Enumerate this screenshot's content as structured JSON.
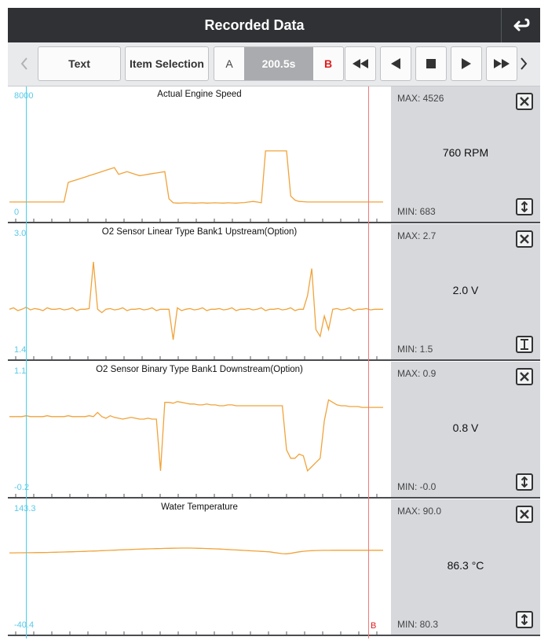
{
  "header": {
    "title": "Recorded Data",
    "back_icon": "return-arrow-icon"
  },
  "toolbar": {
    "text_label": "Text",
    "item_selection_label": "Item Selection",
    "a_label": "A",
    "time_value": "200.5s",
    "b_label": "B",
    "icons": [
      "chevron-left-icon",
      "fast-rewind-icon",
      "step-back-icon",
      "stop-icon",
      "play-icon",
      "fast-forward-icon",
      "chevron-right-icon"
    ]
  },
  "cursor_b_label": "B",
  "colors": {
    "trace": "#f0a33a",
    "cursor_a": "#41d2ea",
    "cursor_b": "#f07a7a",
    "side_panel": "#d6d8dc"
  },
  "panels": [
    {
      "title": "Actual Engine Speed",
      "y_max": "8000",
      "y_min": "0",
      "max_label": "MAX: 4526",
      "min_label": "MIN: 683",
      "current_value": "760 RPM",
      "scale_icon": "expand-vertical-icon",
      "y_range": [
        0,
        8000
      ],
      "values": [
        760,
        760,
        760,
        760,
        760,
        760,
        760,
        760,
        760,
        760,
        760,
        760,
        760,
        760,
        2200,
        2300,
        2400,
        2500,
        2600,
        2700,
        2800,
        2900,
        3000,
        3100,
        3200,
        3300,
        2800,
        2900,
        3000,
        2900,
        2800,
        2700,
        2750,
        2800,
        2850,
        2900,
        2950,
        3000,
        1000,
        700,
        680,
        683,
        700,
        690,
        680,
        690,
        700,
        680,
        690,
        700,
        690,
        680,
        700,
        690,
        680,
        700,
        720,
        760,
        800,
        760,
        700,
        4526,
        4526,
        4526,
        4526,
        4526,
        4526,
        1200,
        900,
        800,
        780,
        760,
        760,
        760,
        760,
        760,
        760,
        760,
        760,
        760,
        760,
        760,
        760,
        760,
        760,
        760,
        760,
        760,
        760,
        760
      ]
    },
    {
      "title": "O2 Sensor Linear Type Bank1 Upstream(Option)",
      "y_max": "3.0",
      "y_min": "1.4",
      "max_label": "MAX: 2.7",
      "min_label": "MIN: 1.5",
      "current_value": "2.0 V",
      "scale_icon": "fit-vertical-icon",
      "y_range": [
        1.4,
        3.0
      ],
      "values": [
        2.0,
        2.02,
        1.98,
        2.0,
        2.03,
        1.99,
        2.01,
        2.0,
        1.98,
        2.02,
        2.0,
        2.0,
        2.01,
        1.99,
        2.0,
        2.02,
        1.98,
        2.0,
        2.0,
        2.01,
        2.7,
        2.0,
        1.95,
        2.0,
        2.01,
        1.99,
        2.0,
        2.02,
        1.98,
        2.0,
        2.0,
        2.01,
        1.99,
        2.0,
        2.02,
        1.98,
        2.0,
        2.0,
        2.0,
        1.55,
        2.02,
        1.98,
        2.0,
        2.01,
        1.99,
        2.0,
        2.02,
        1.98,
        2.0,
        2.0,
        2.01,
        1.99,
        2.0,
        2.02,
        1.98,
        2.0,
        2.0,
        2.01,
        1.99,
        2.0,
        2.02,
        1.98,
        2.0,
        2.0,
        2.01,
        1.99,
        2.0,
        2.02,
        1.98,
        2.0,
        2.0,
        2.2,
        2.6,
        1.7,
        1.6,
        1.9,
        1.7,
        2.0,
        2.01,
        1.99,
        2.0,
        2.02,
        1.98,
        2.0,
        2.0,
        2.01,
        1.99,
        2.0,
        2.0,
        2.0
      ]
    },
    {
      "title": "O2 Sensor Binary Type Bank1 Downstream(Option)",
      "y_max": "1.1",
      "y_min": "-0.2",
      "max_label": "MAX: 0.9",
      "min_label": "MIN: -0.0",
      "current_value": "0.8 V",
      "scale_icon": "expand-vertical-icon",
      "y_range": [
        -0.2,
        1.1
      ],
      "values": [
        0.65,
        0.65,
        0.65,
        0.65,
        0.66,
        0.65,
        0.65,
        0.65,
        0.65,
        0.66,
        0.65,
        0.65,
        0.65,
        0.65,
        0.66,
        0.65,
        0.65,
        0.65,
        0.65,
        0.66,
        0.65,
        0.7,
        0.65,
        0.63,
        0.66,
        0.64,
        0.63,
        0.62,
        0.63,
        0.64,
        0.63,
        0.62,
        0.62,
        0.63,
        0.62,
        0.62,
        0.0,
        0.82,
        0.82,
        0.81,
        0.83,
        0.82,
        0.81,
        0.8,
        0.8,
        0.79,
        0.79,
        0.8,
        0.79,
        0.79,
        0.78,
        0.78,
        0.79,
        0.79,
        0.78,
        0.78,
        0.78,
        0.78,
        0.78,
        0.78,
        0.78,
        0.78,
        0.78,
        0.78,
        0.78,
        0.78,
        0.25,
        0.15,
        0.15,
        0.2,
        0.18,
        0.0,
        0.05,
        0.1,
        0.15,
        0.6,
        0.85,
        0.82,
        0.79,
        0.78,
        0.78,
        0.77,
        0.77,
        0.77,
        0.76,
        0.76,
        0.76,
        0.76,
        0.76,
        0.76
      ]
    },
    {
      "title": "Water Temperature",
      "y_max": "143.3",
      "y_min": "-40.4",
      "max_label": "MAX: 90.0",
      "min_label": "MIN: 80.3",
      "current_value": "86.3 °C",
      "scale_icon": "expand-vertical-icon",
      "y_range": [
        -40.4,
        143.3
      ],
      "values": [
        82.0,
        82.0,
        82.1,
        82.1,
        82.2,
        82.2,
        82.3,
        82.4,
        82.5,
        82.6,
        82.8,
        83.0,
        83.2,
        83.4,
        83.6,
        83.8,
        84.0,
        84.2,
        84.5,
        84.8,
        85.0,
        85.3,
        85.6,
        85.9,
        86.2,
        86.5,
        86.8,
        87.1,
        87.4,
        87.7,
        88.0,
        88.2,
        88.5,
        88.7,
        88.9,
        89.1,
        89.3,
        89.5,
        89.7,
        89.8,
        89.9,
        90.0,
        90.0,
        90.0,
        89.9,
        89.7,
        89.5,
        89.3,
        89.0,
        88.7,
        88.4,
        88.0,
        87.7,
        87.3,
        86.9,
        86.5,
        86.1,
        85.7,
        85.3,
        84.9,
        84.5,
        84.1,
        83.6,
        82.5,
        81.5,
        80.6,
        80.3,
        81.2,
        82.4,
        83.6,
        84.6,
        85.2,
        85.6,
        85.9,
        86.1,
        86.2,
        86.2,
        86.3,
        86.3,
        86.3,
        86.3,
        86.3,
        86.3,
        86.3,
        86.3,
        86.3,
        86.3,
        86.3,
        86.3,
        86.3
      ]
    }
  ]
}
